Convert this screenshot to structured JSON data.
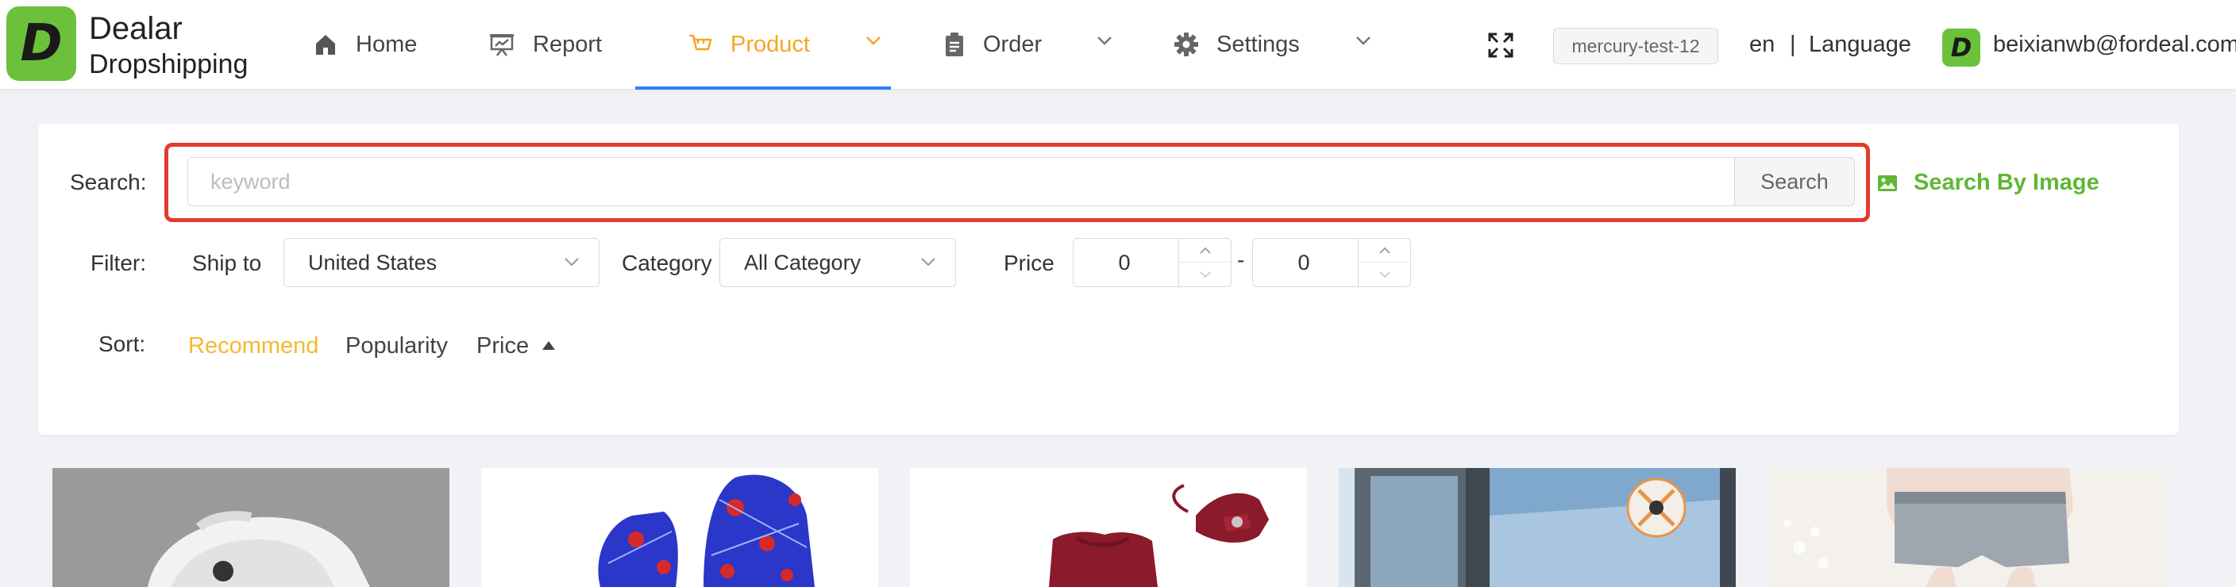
{
  "brand": {
    "logo_letter": "D",
    "name_line1": "Dealar",
    "name_line2": "Dropshipping",
    "accent": "#6bc23a"
  },
  "nav": {
    "items": [
      {
        "label": "Home",
        "icon": "home-icon"
      },
      {
        "label": "Report",
        "icon": "report-icon"
      },
      {
        "label": "Product",
        "icon": "cart-icon",
        "active": true
      },
      {
        "label": "Order",
        "icon": "clipboard-icon"
      },
      {
        "label": "Settings",
        "icon": "gear-icon"
      }
    ],
    "active_color": "#f5a623",
    "underline_color": "#2d7ff9"
  },
  "header": {
    "env_badge": "mercury-test-12",
    "lang_code": "en",
    "lang_separator": "|",
    "lang_label": "Language",
    "user_avatar_letter": "D",
    "user_email": "beixianwb@fordeal.com"
  },
  "search": {
    "label": "Search:",
    "placeholder": "keyword",
    "value": "",
    "button": "Search",
    "by_image": "Search By Image",
    "highlight_color": "#e33b2e"
  },
  "filter": {
    "label": "Filter:",
    "ship_to_label": "Ship to",
    "ship_to_value": "United States",
    "category_label": "Category",
    "category_value": "All Category",
    "price_label": "Price",
    "price_min": "0",
    "price_separator": "-",
    "price_max": "0"
  },
  "sort": {
    "label": "Sort:",
    "options": [
      "Recommend",
      "Popularity",
      "Price"
    ],
    "active": "Recommend",
    "price_direction": "ascending"
  },
  "products": [
    {
      "image": "white-clog-shoe"
    },
    {
      "image": "blue-spiderman-hoodie"
    },
    {
      "image": "red-dress-with-bow"
    },
    {
      "image": "window-insect-screen"
    },
    {
      "image": "denim-shorts"
    }
  ]
}
